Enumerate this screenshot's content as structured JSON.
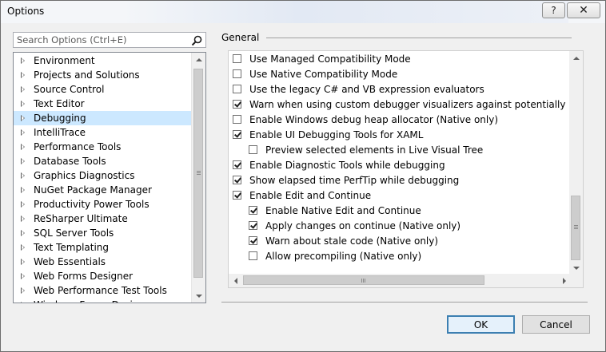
{
  "window": {
    "title": "Options",
    "help_label": "?",
    "close_label": "✕"
  },
  "search": {
    "placeholder": "Search Options (Ctrl+E)"
  },
  "tree": {
    "items": [
      {
        "label": "Environment",
        "selected": false
      },
      {
        "label": "Projects and Solutions",
        "selected": false
      },
      {
        "label": "Source Control",
        "selected": false
      },
      {
        "label": "Text Editor",
        "selected": false
      },
      {
        "label": "Debugging",
        "selected": true
      },
      {
        "label": "IntelliTrace",
        "selected": false
      },
      {
        "label": "Performance Tools",
        "selected": false
      },
      {
        "label": "Database Tools",
        "selected": false
      },
      {
        "label": "Graphics Diagnostics",
        "selected": false
      },
      {
        "label": "NuGet Package Manager",
        "selected": false
      },
      {
        "label": "Productivity Power Tools",
        "selected": false
      },
      {
        "label": "ReSharper Ultimate",
        "selected": false
      },
      {
        "label": "SQL Server Tools",
        "selected": false
      },
      {
        "label": "Text Templating",
        "selected": false
      },
      {
        "label": "Web Essentials",
        "selected": false
      },
      {
        "label": "Web Forms Designer",
        "selected": false
      },
      {
        "label": "Web Performance Test Tools",
        "selected": false
      },
      {
        "label": "Windows Forms Designer",
        "selected": false
      }
    ]
  },
  "general": {
    "label": "General",
    "options": [
      {
        "label": "Use Managed Compatibility Mode",
        "checked": false,
        "indent": 0
      },
      {
        "label": "Use Native Compatibility Mode",
        "checked": false,
        "indent": 0
      },
      {
        "label": "Use the legacy C# and VB expression evaluators",
        "checked": false,
        "indent": 0
      },
      {
        "label": "Warn when using custom debugger visualizers against potentially unsafe processes",
        "checked": true,
        "indent": 0
      },
      {
        "label": "Enable Windows debug heap allocator (Native only)",
        "checked": false,
        "indent": 0
      },
      {
        "label": "Enable UI Debugging Tools for XAML",
        "checked": true,
        "indent": 0
      },
      {
        "label": "Preview selected elements in Live Visual Tree",
        "checked": false,
        "indent": 1
      },
      {
        "label": "Enable Diagnostic Tools while debugging",
        "checked": true,
        "indent": 0
      },
      {
        "label": "Show elapsed time PerfTip while debugging",
        "checked": true,
        "indent": 0
      },
      {
        "label": "Enable Edit and Continue",
        "checked": true,
        "indent": 0
      },
      {
        "label": "Enable Native Edit and Continue",
        "checked": true,
        "indent": 1
      },
      {
        "label": "Apply changes on continue (Native only)",
        "checked": true,
        "indent": 1
      },
      {
        "label": "Warn about stale code (Native only)",
        "checked": true,
        "indent": 1
      },
      {
        "label": "Allow precompiling (Native only)",
        "checked": false,
        "indent": 1
      }
    ]
  },
  "buttons": {
    "ok": "OK",
    "cancel": "Cancel"
  },
  "colors": {
    "selection": "#cce8ff",
    "default_button_border": "#3c7fb1"
  }
}
